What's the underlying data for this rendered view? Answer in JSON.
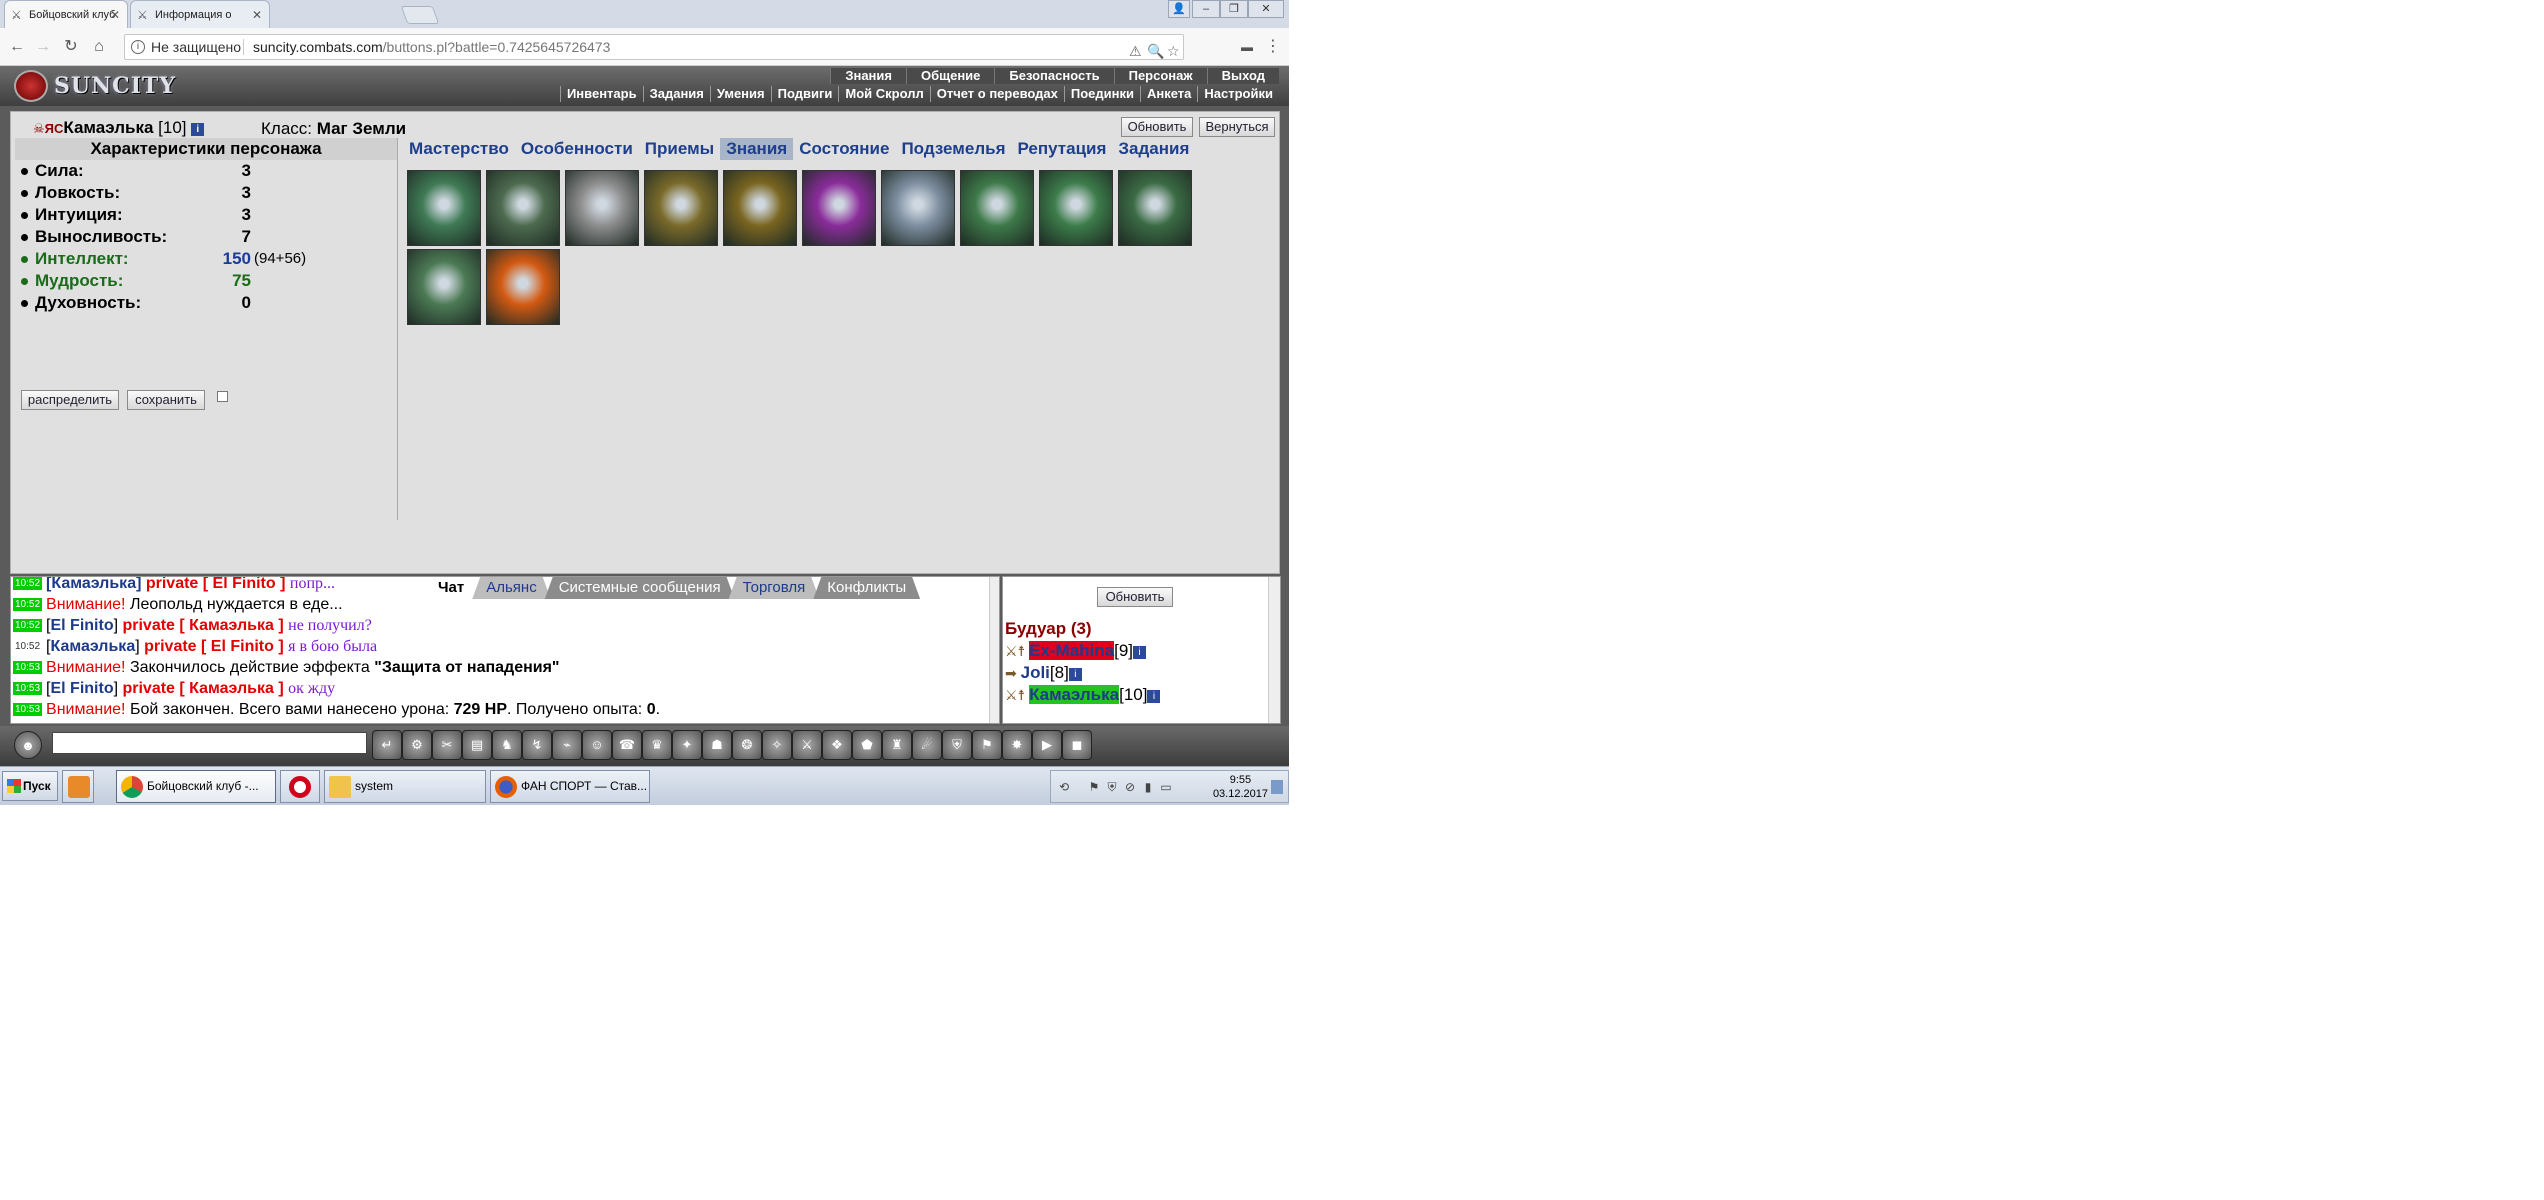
{
  "browser": {
    "tabs": [
      {
        "title": "Бойцовский клуб",
        "active": true
      },
      {
        "title": "Информация о Камаэлька",
        "active": false
      }
    ],
    "security": "Не защищено",
    "url_host": "suncity.combats.com",
    "url_path": "/buttons.pl?battle=0.7425645726473"
  },
  "game": {
    "logo": "SUNCITY",
    "menu_top": [
      "Знания",
      "Общение",
      "Безопасность",
      "Персонаж",
      "Выход"
    ],
    "menu_sub": [
      "Инвентарь",
      "Задания",
      "Умения",
      "Подвиги",
      "Мой Скролл",
      "Отчет о переводах",
      "Поединки",
      "Анкета",
      "Настройки"
    ],
    "character": {
      "clan_symbol": "☠ЯС",
      "name": "Камаэлька",
      "level": "[10]",
      "info_icon": "i",
      "class_label": "Класс:",
      "class_value": "Маг Земли"
    },
    "buttons": {
      "refresh": "Обновить",
      "back": "Вернуться",
      "distribute": "распределить",
      "save": "сохранить"
    },
    "stats_title": "Характеристики персонажа",
    "stats": [
      {
        "name": "Сила:",
        "value": "3",
        "extra": ""
      },
      {
        "name": "Ловкость:",
        "value": "3",
        "extra": ""
      },
      {
        "name": "Интуиция:",
        "value": "3",
        "extra": ""
      },
      {
        "name": "Выносливость:",
        "value": "7",
        "extra": ""
      },
      {
        "name": "Интеллект:",
        "value": "150",
        "extra": "(94+56)"
      },
      {
        "name": "Мудрость:",
        "value": "75",
        "extra": ""
      },
      {
        "name": "Духовность:",
        "value": "0",
        "extra": ""
      }
    ],
    "tabs": [
      "Мастерство",
      "Особенности",
      "Приемы",
      "Знания",
      "Состояние",
      "Подземелья",
      "Репутация",
      "Задания"
    ],
    "selected_tab": "Знания",
    "cards": [
      {
        "color": "#3f7a55"
      },
      {
        "color": "#4d6b4f"
      },
      {
        "color": "#8d8d8d"
      },
      {
        "color": "#7a6a2a"
      },
      {
        "color": "#7a6520"
      },
      {
        "color": "#8a2c9a"
      },
      {
        "color": "#7d8ea0"
      },
      {
        "color": "#3e7a4a"
      },
      {
        "color": "#3c7c4a"
      },
      {
        "color": "#3b6b44"
      },
      {
        "color": "#4c7a55"
      },
      {
        "color": "#d35a12"
      }
    ]
  },
  "chat": {
    "tabs": [
      "Чат",
      "Альянс",
      "Системные сообщения",
      "Торговля",
      "Конфликты"
    ],
    "lines": [
      {
        "ts": "10:52",
        "html_parts": [
          "[Камаэлька] ",
          "private [ El Finito ] ",
          "попр..."
        ]
      },
      {
        "ts": "10:52",
        "alert": "Внимание!",
        "text": " Леопольд нуждается в еде..."
      },
      {
        "ts": "10:52",
        "from": "El Finito",
        "to": "Камаэлька",
        "msg": "не получил?"
      },
      {
        "ts": "10:52",
        "from": "Камаэлька",
        "to": "El Finito",
        "msg": "я в бою была"
      },
      {
        "ts": "10:53",
        "alert": "Внимание!",
        "text": " Закончилось действие эффекта ",
        "bold": "\"Защита от нападения\""
      },
      {
        "ts": "10:53",
        "from": "El Finito",
        "to": "Камаэлька",
        "msg": "ок жду"
      },
      {
        "ts": "10:53",
        "alert": "Внимание!",
        "text": " Бой закончен. Всего вами нанесено урона: ",
        "bold": "729 HP",
        "text2": ". Получено опыта: ",
        "bold2": "0",
        "text3": "."
      }
    ],
    "private_label": "private",
    "alert_label": "Внимание!"
  },
  "room": {
    "refresh": "Обновить",
    "title": "Будуар (3)",
    "users": [
      {
        "name": "Ex-Mahina",
        "level": "[9]",
        "hl": "red"
      },
      {
        "name": "Joli",
        "level": "[8]",
        "hl": "none"
      },
      {
        "name": "Камаэлька",
        "level": "[10]",
        "hl": "green"
      }
    ]
  },
  "taskbar": {
    "start": "Пуск",
    "items": [
      {
        "label": "Бойцовский клуб -...",
        "active": true
      },
      {
        "label": "system",
        "active": false
      },
      {
        "label": "ФАН СПОРТ — Став...",
        "active": false
      }
    ],
    "time": "9:55",
    "date": "03.12.2017"
  }
}
